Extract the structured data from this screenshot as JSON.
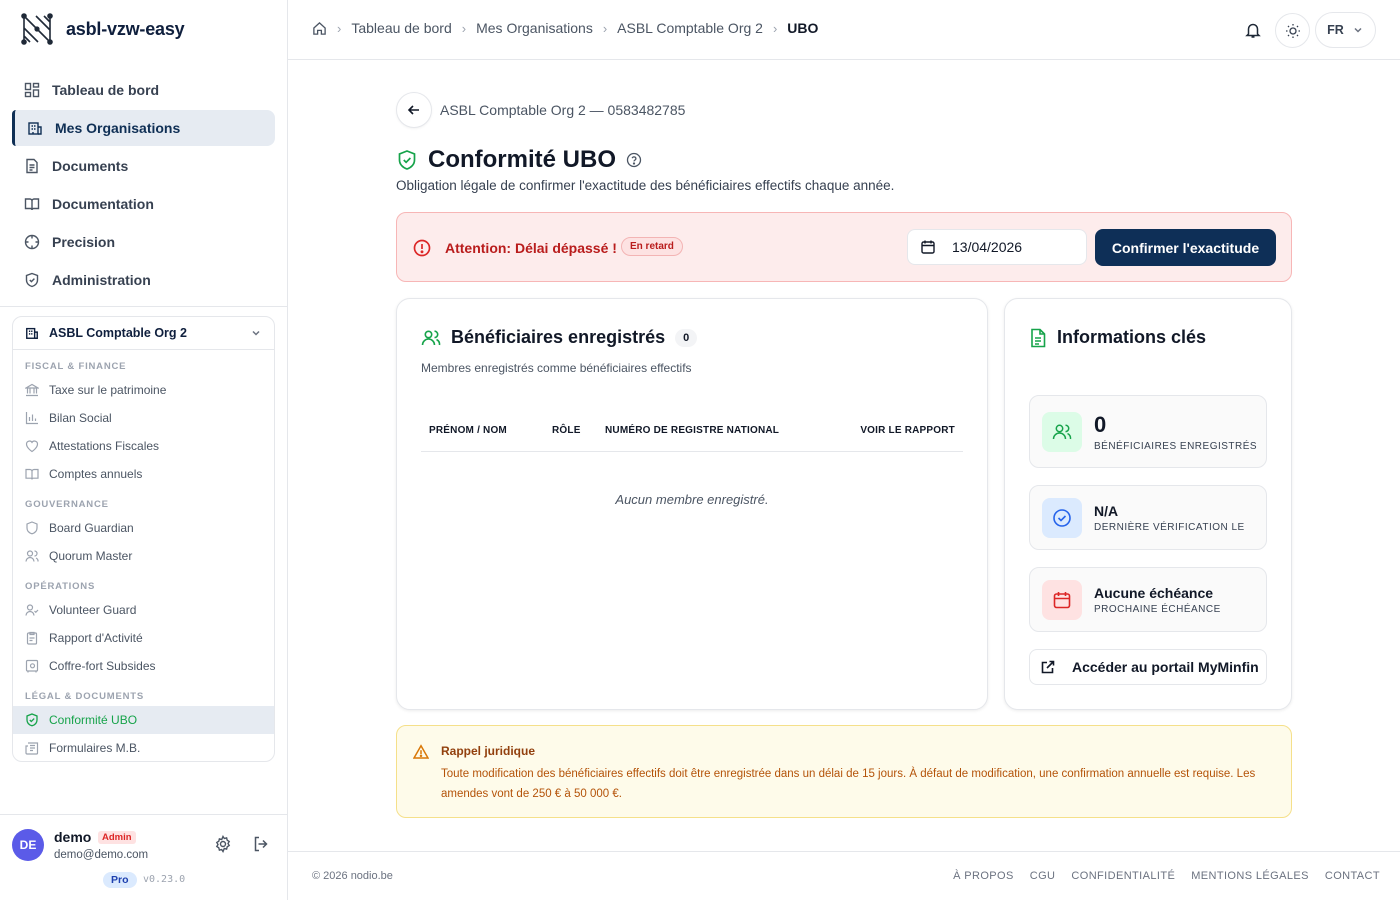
{
  "app": {
    "name": "asbl-vzw-easy"
  },
  "nav": [
    {
      "label": "Tableau de bord",
      "icon": "dashboard-icon"
    },
    {
      "label": "Mes Organisations",
      "icon": "building-icon",
      "active": true
    },
    {
      "label": "Documents",
      "icon": "document-icon"
    },
    {
      "label": "Documentation",
      "icon": "book-icon"
    },
    {
      "label": "Precision",
      "icon": "crosshair-icon"
    },
    {
      "label": "Administration",
      "icon": "shield-icon"
    }
  ],
  "org": {
    "name": "ASBL Comptable Org 2",
    "sections": [
      {
        "title": "FISCAL & FINANCE",
        "items": [
          "Taxe sur le patrimoine",
          "Bilan Social",
          "Attestations Fiscales",
          "Comptes annuels"
        ]
      },
      {
        "title": "GOUVERNANCE",
        "items": [
          "Board Guardian",
          "Quorum Master"
        ]
      },
      {
        "title": "OPÉRATIONS",
        "items": [
          "Volunteer Guard",
          "Rapport d'Activité",
          "Coffre-fort Subsides"
        ]
      },
      {
        "title": "LÉGAL & DOCUMENTS",
        "items": [
          "Conformité UBO",
          "Formulaires M.B."
        ]
      }
    ]
  },
  "user": {
    "initials": "DE",
    "name": "demo",
    "role": "Admin",
    "email": "demo@demo.com",
    "plan": "Pro",
    "version": "v0.23.0"
  },
  "breadcrumb": [
    "Tableau de bord",
    "Mes Organisations",
    "ASBL Comptable Org 2",
    "UBO"
  ],
  "header": {
    "lang": "FR"
  },
  "page": {
    "back_label": "ASBL Comptable Org 2 — 0583482785",
    "title": "Conformité UBO",
    "subtitle": "Obligation légale de confirmer l'exactitude des bénéficiaires effectifs chaque année."
  },
  "alert": {
    "text": "Attention: Délai dépassé !",
    "badge": "En retard",
    "date": "13/04/2026",
    "confirm_label": "Confirmer l'exactitude"
  },
  "beneficiaries": {
    "title": "Bénéficiaires enregistrés",
    "count": "0",
    "subtitle": "Membres enregistrés comme bénéficiaires effectifs",
    "columns": [
      "PRÉNOM / NOM",
      "RÔLE",
      "NUMÉRO DE REGISTRE NATIONAL",
      "VOIR LE RAPPORT"
    ],
    "empty": "Aucun membre enregistré."
  },
  "info": {
    "title": "Informations clés",
    "stats": [
      {
        "value": "0",
        "label": "BÉNÉFICIAIRES ENREGISTRÉS",
        "color": "#16a34a"
      },
      {
        "value": "N/A",
        "label": "DERNIÈRE VÉRIFICATION LE",
        "color": "#2563eb"
      },
      {
        "value": "Aucune échéance",
        "label": "PROCHAINE ÉCHÉANCE",
        "color": "#dc2626"
      }
    ],
    "portal_label": "Accéder au portail MyMinfin"
  },
  "reminder": {
    "title": "Rappel juridique",
    "text": "Toute modification des bénéficiaires effectifs doit être enregistrée dans un délai de 15 jours. À défaut de modification, une confirmation annuelle est requise. Les amendes vont de 250 € à 50 000 €."
  },
  "footer": {
    "copyright": "© 2026 nodio.be",
    "links": [
      "À PROPOS",
      "CGU",
      "CONFIDENTIALITÉ",
      "MENTIONS LÉGALES",
      "CONTACT"
    ]
  },
  "colors": {
    "primary": "#0e2f57",
    "danger": "#dc2626",
    "success": "#16a34a",
    "warning": "#d97706"
  }
}
